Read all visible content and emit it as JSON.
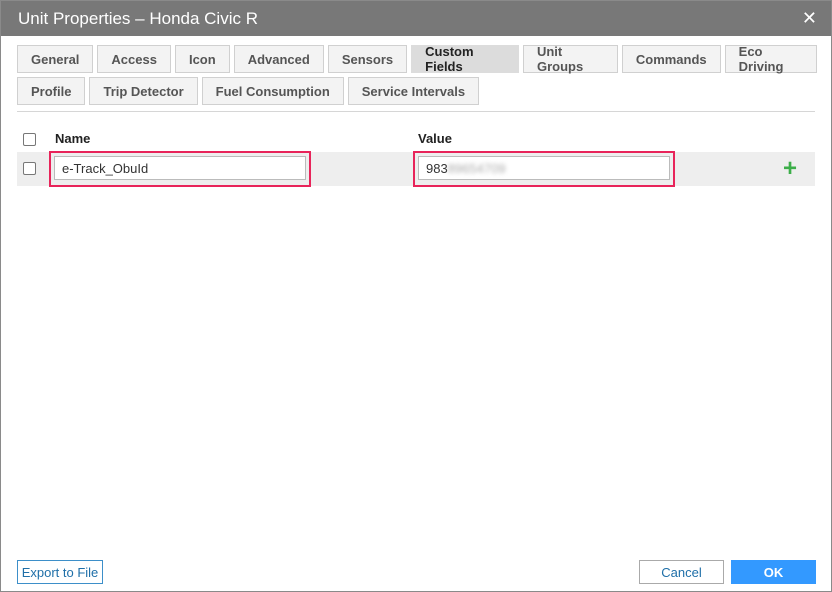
{
  "window": {
    "title": "Unit Properties – Honda Civic R",
    "close": "✕"
  },
  "tabs": {
    "row1": [
      "General",
      "Access",
      "Icon",
      "Advanced",
      "Sensors",
      "Custom Fields",
      "Unit Groups",
      "Commands",
      "Eco Driving"
    ],
    "row2": [
      "Profile",
      "Trip Detector",
      "Fuel Consumption",
      "Service Intervals"
    ],
    "active": "Custom Fields"
  },
  "table": {
    "headers": {
      "name": "Name",
      "value": "Value"
    },
    "row": {
      "name": "e-Track_ObuId",
      "value_visible": "983",
      "value_blurred": "89654709"
    }
  },
  "footer": {
    "export": "Export to File",
    "cancel": "Cancel",
    "ok": "OK"
  },
  "icons": {
    "add": "+"
  },
  "colors": {
    "accent": "#3399ff",
    "highlight": "#e8245a",
    "add": "#3cae49"
  }
}
